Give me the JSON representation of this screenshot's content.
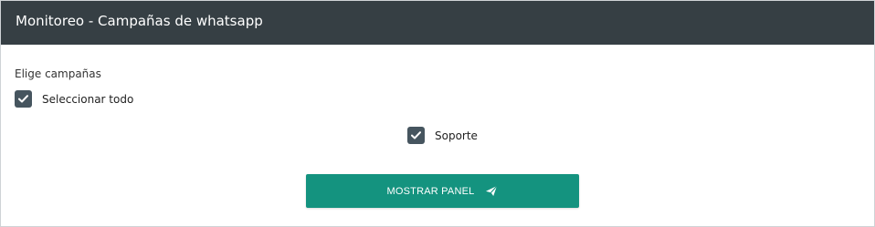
{
  "header": {
    "title": "Monitoreo - Campañas de whatsapp"
  },
  "campaigns": {
    "label": "Elige campañas",
    "select_all": {
      "label": "Seleccionar todo",
      "checked": true
    },
    "items": [
      {
        "label": "Soporte",
        "checked": true
      }
    ]
  },
  "actions": {
    "show_panel_label": "MOSTRAR PANEL",
    "show_panel_icon": "send-icon"
  },
  "colors": {
    "header_bg": "#363f44",
    "checkbox_bg": "#46555f",
    "button_bg": "#14937f"
  }
}
